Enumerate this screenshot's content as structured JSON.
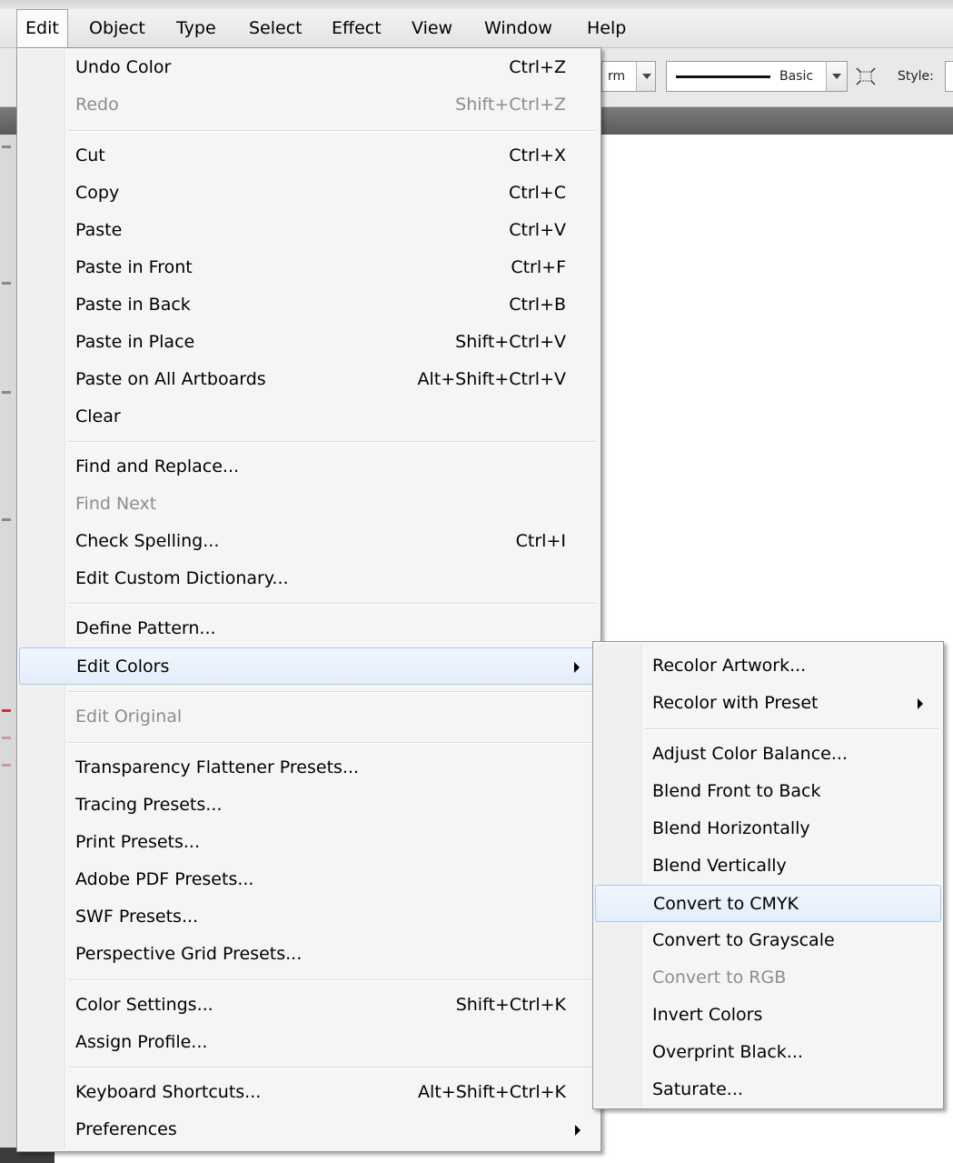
{
  "menubar": {
    "items": [
      "Edit",
      "Object",
      "Type",
      "Select",
      "Effect",
      "View",
      "Window",
      "Help"
    ]
  },
  "controlbar": {
    "partial_field_text": "rm",
    "brush_label": "Basic",
    "style_label": "Style:"
  },
  "edit_menu": {
    "items": [
      {
        "label": "Undo Color",
        "shortcut": "Ctrl+Z",
        "disabled": false
      },
      {
        "label": "Redo",
        "shortcut": "Shift+Ctrl+Z",
        "disabled": true
      },
      {
        "label": "Cut",
        "shortcut": "Ctrl+X",
        "disabled": false
      },
      {
        "label": "Copy",
        "shortcut": "Ctrl+C",
        "disabled": false
      },
      {
        "label": "Paste",
        "shortcut": "Ctrl+V",
        "disabled": false
      },
      {
        "label": "Paste in Front",
        "shortcut": "Ctrl+F",
        "disabled": false
      },
      {
        "label": "Paste in Back",
        "shortcut": "Ctrl+B",
        "disabled": false
      },
      {
        "label": "Paste in Place",
        "shortcut": "Shift+Ctrl+V",
        "disabled": false
      },
      {
        "label": "Paste on All Artboards",
        "shortcut": "Alt+Shift+Ctrl+V",
        "disabled": false
      },
      {
        "label": "Clear",
        "shortcut": "",
        "disabled": false
      },
      {
        "label": "Find and Replace...",
        "shortcut": "",
        "disabled": false
      },
      {
        "label": "Find Next",
        "shortcut": "",
        "disabled": true
      },
      {
        "label": "Check Spelling...",
        "shortcut": "Ctrl+I",
        "disabled": false
      },
      {
        "label": "Edit Custom Dictionary...",
        "shortcut": "",
        "disabled": false
      },
      {
        "label": "Define Pattern...",
        "shortcut": "",
        "disabled": false
      },
      {
        "label": "Edit Colors",
        "shortcut": "",
        "disabled": false,
        "submenu": true,
        "highlighted": true
      },
      {
        "label": "Edit Original",
        "shortcut": "",
        "disabled": true
      },
      {
        "label": "Transparency Flattener Presets...",
        "shortcut": "",
        "disabled": false
      },
      {
        "label": "Tracing Presets...",
        "shortcut": "",
        "disabled": false
      },
      {
        "label": "Print Presets...",
        "shortcut": "",
        "disabled": false
      },
      {
        "label": "Adobe PDF Presets...",
        "shortcut": "",
        "disabled": false
      },
      {
        "label": "SWF Presets...",
        "shortcut": "",
        "disabled": false
      },
      {
        "label": "Perspective Grid Presets...",
        "shortcut": "",
        "disabled": false
      },
      {
        "label": "Color Settings...",
        "shortcut": "Shift+Ctrl+K",
        "disabled": false
      },
      {
        "label": "Assign Profile...",
        "shortcut": "",
        "disabled": false
      },
      {
        "label": "Keyboard Shortcuts...",
        "shortcut": "Alt+Shift+Ctrl+K",
        "disabled": false
      },
      {
        "label": "Preferences",
        "shortcut": "",
        "disabled": false,
        "submenu": true
      }
    ]
  },
  "edit_colors_submenu": {
    "items": [
      {
        "label": "Recolor Artwork...",
        "disabled": false
      },
      {
        "label": "Recolor with Preset",
        "disabled": false,
        "submenu": true
      },
      {
        "label": "Adjust Color Balance...",
        "disabled": false
      },
      {
        "label": "Blend Front to Back",
        "disabled": false
      },
      {
        "label": "Blend Horizontally",
        "disabled": false
      },
      {
        "label": "Blend Vertically",
        "disabled": false
      },
      {
        "label": "Convert to CMYK",
        "disabled": false,
        "highlighted": true
      },
      {
        "label": "Convert to Grayscale",
        "disabled": false
      },
      {
        "label": "Convert to RGB",
        "disabled": true
      },
      {
        "label": "Invert Colors",
        "disabled": false
      },
      {
        "label": "Overprint Black...",
        "disabled": false
      },
      {
        "label": "Saturate...",
        "disabled": false
      }
    ]
  },
  "colors": {
    "menu_bg": "#f5f5f5",
    "highlight_border": "#a9c7ec",
    "disabled_text": "#8d8d8d"
  }
}
